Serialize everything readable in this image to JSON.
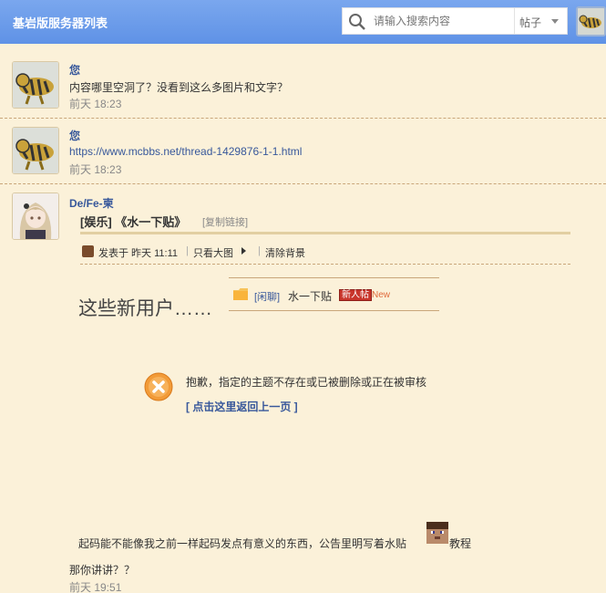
{
  "header": {
    "title": "基岩版服务器列表",
    "search_placeholder": "请输入搜索内容",
    "search_type": "帖子"
  },
  "posts": [
    {
      "author": "您",
      "text": "内容哪里空洞了？没看到这么多图片和文字？",
      "time": "前天 18:23"
    },
    {
      "author": "您",
      "text": "https://www.mcbbs.net/thread-1429876-1-1.html",
      "time": "前天 18:23"
    },
    {
      "author": "De/Fe-柬"
    }
  ],
  "quote": {
    "title": "[娱乐] 《水一下贴》",
    "copy_link": "[复制链接]",
    "posted_label": "发表于 昨天 11:11",
    "view_image": "只看大图",
    "clear_bg": "清除背景",
    "body_big": "这些新用户……",
    "thread_tag": "[闲聊]",
    "thread_title": "水一下贴",
    "new_badge": "新人帖",
    "new_label": "New",
    "error_message": "抱歉，指定的主题不存在或已被删除或正在被审核",
    "error_back": "[ 点击这里返回上一页 ]",
    "bottom_text": "起码能不能像我之前一样起码发点有意义的东西，公告里明写着水贴",
    "bottom_tail": "教程"
  },
  "reply": {
    "text": "那你讲讲？？",
    "time": "前天 19:51"
  },
  "colors": {
    "header_blue": "#6a9be8",
    "background": "#fbf1d9",
    "link_blue": "#38589b",
    "error_orange": "#f29b38",
    "badge_red": "#c8352b"
  }
}
